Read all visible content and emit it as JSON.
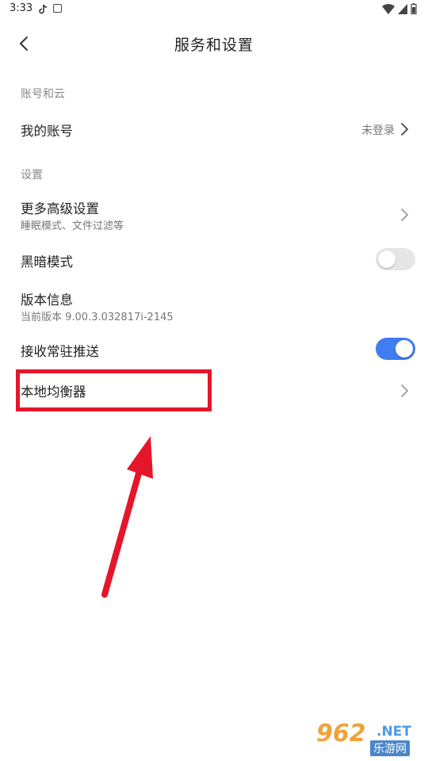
{
  "status_bar": {
    "time": "3:33"
  },
  "header": {
    "title": "服务和设置"
  },
  "sections": {
    "account": {
      "label": "账号和云",
      "my_account": {
        "title": "我的账号",
        "value": "未登录"
      }
    },
    "settings": {
      "label": "设置",
      "advanced": {
        "title": "更多高级设置",
        "subtitle": "睡眠模式、文件过滤等"
      },
      "dark_mode": {
        "title": "黑暗模式",
        "enabled": false
      },
      "version": {
        "title": "版本信息",
        "subtitle": "当前版本 9.00.3.032817i-2145"
      },
      "push": {
        "title": "接收常驻推送",
        "enabled": true
      },
      "equalizer": {
        "title": "本地均衡器"
      }
    }
  },
  "watermark": {
    "number": "962",
    "domain": ".NET",
    "name": "乐游网"
  },
  "colors": {
    "accent": "#3f7df0",
    "annotation": "#e5162a"
  }
}
